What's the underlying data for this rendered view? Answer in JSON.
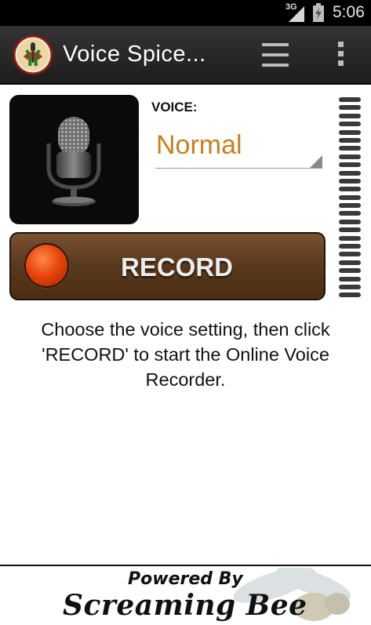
{
  "status_bar": {
    "network": "3G",
    "time": "5:06",
    "icons": [
      "signal-icon",
      "battery-charging-icon"
    ]
  },
  "action_bar": {
    "title": "Voice Spice...",
    "icons": [
      "app-logo-icon",
      "menu-icon",
      "overflow-menu-icon"
    ]
  },
  "voice": {
    "label": "VOICE:",
    "selected": "Normal"
  },
  "record": {
    "label": "RECORD",
    "dot_color": "#e8460c"
  },
  "instruction": "Choose the voice setting, then click 'RECORD' to start the Online Voice Recorder.",
  "footer": {
    "powered_by": "Powered By",
    "brand": "Screaming Bee"
  },
  "colors": {
    "accent": "#c87f1e",
    "record_button": "#5b3a1e",
    "action_bar": "#2a2a2a"
  }
}
